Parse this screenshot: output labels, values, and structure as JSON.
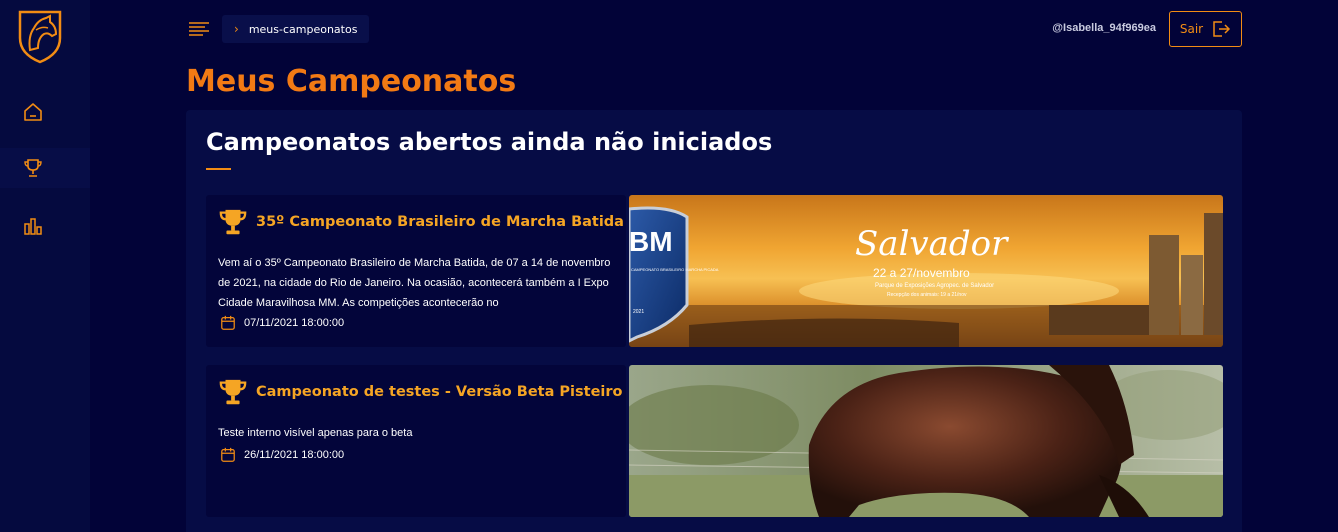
{
  "sidebar": {
    "logo": "horse-head-logo",
    "items": [
      {
        "name": "home",
        "icon": "home-icon"
      },
      {
        "name": "campeonatos",
        "icon": "trophy-icon",
        "active": true
      },
      {
        "name": "stats",
        "icon": "bar-chart-icon"
      }
    ]
  },
  "topbar": {
    "menu_icon": "menu-lines-icon",
    "breadcrumb": "meus-campeonatos",
    "username": "@Isabella_94f969ea",
    "logout_label": "Sair"
  },
  "page": {
    "title": "Meus Campeonatos",
    "section_title": "Campeonatos abertos ainda não iniciados"
  },
  "championships": [
    {
      "title": "35º Campeonato Brasileiro de Marcha Batida",
      "description": "Vem aí o 35º Campeonato Brasileiro de Marcha Batida, de 07 a 14 de novembro de 2021, na cidade do Rio de Janeiro. Na ocasião, acontecerá também a I Expo Cidade Maravilhosa MM. As competições acontecerão no",
      "date": "07/11/2021 18:00:00",
      "banner": {
        "badge": "BM",
        "badge_sub": "CAMPEONATO BRASILEIRO MARCHA PICADA",
        "badge_year": "2021",
        "city": "Salvador",
        "dates": "22 a 27/novembro",
        "venue": "Parque de Exposições Agropec. de Salvador",
        "reception": "Recepção dos animais: 19 a 21/nov"
      }
    },
    {
      "title": "Campeonato de testes - Versão Beta Pisteiro",
      "description": "Teste interno visível apenas para o beta",
      "date": "26/11/2021 18:00:00"
    }
  ],
  "colors": {
    "accent": "#f28c14",
    "title": "#f27a14",
    "card_title": "#f5a524",
    "background": "#020338"
  }
}
